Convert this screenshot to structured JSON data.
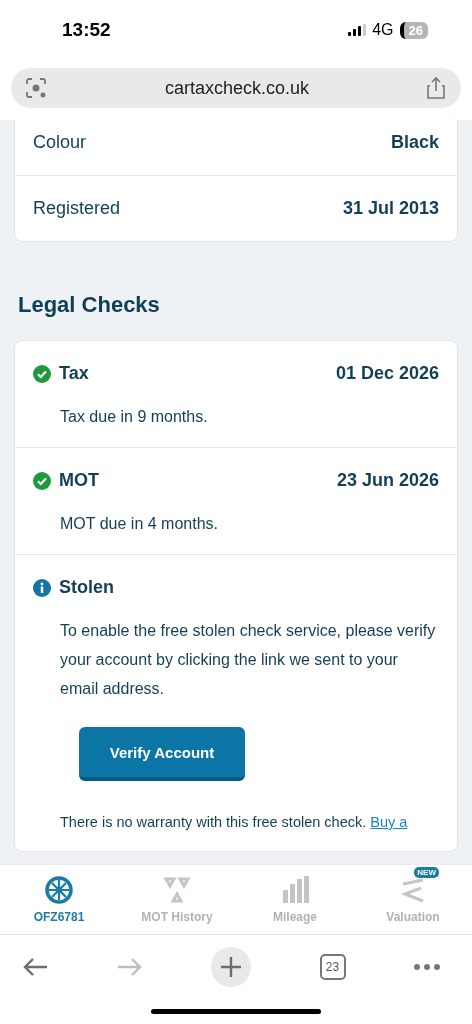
{
  "status_bar": {
    "time": "13:52",
    "network": "4G",
    "battery": "26"
  },
  "address_bar": {
    "url": "cartaxcheck.co.uk"
  },
  "vehicle_details": [
    {
      "label": "Colour",
      "value": "Black"
    },
    {
      "label": "Registered",
      "value": "31 Jul 2013"
    }
  ],
  "legal_checks": {
    "title": "Legal Checks",
    "items": [
      {
        "name": "Tax",
        "kind": "ok",
        "date": "01 Dec 2026",
        "note": "Tax due in 9 months."
      },
      {
        "name": "MOT",
        "kind": "ok",
        "date": "23 Jun 2026",
        "note": "MOT due in 4 months."
      },
      {
        "name": "Stolen",
        "kind": "info",
        "note": "To enable the free stolen check service, please verify your account by clicking the link we sent to your email address.",
        "button": "Verify Account",
        "disclaimer": "There is no warranty with this free stolen check.",
        "link": "Buy a"
      }
    ]
  },
  "tab_bar": [
    {
      "label": "OFZ6781",
      "selected": true
    },
    {
      "label": "MOT History",
      "selected": false
    },
    {
      "label": "Mileage",
      "selected": false
    },
    {
      "label": "Valuation",
      "selected": false,
      "badge": "NEW"
    }
  ],
  "browser_toolbar": {
    "tab_count": "23"
  }
}
